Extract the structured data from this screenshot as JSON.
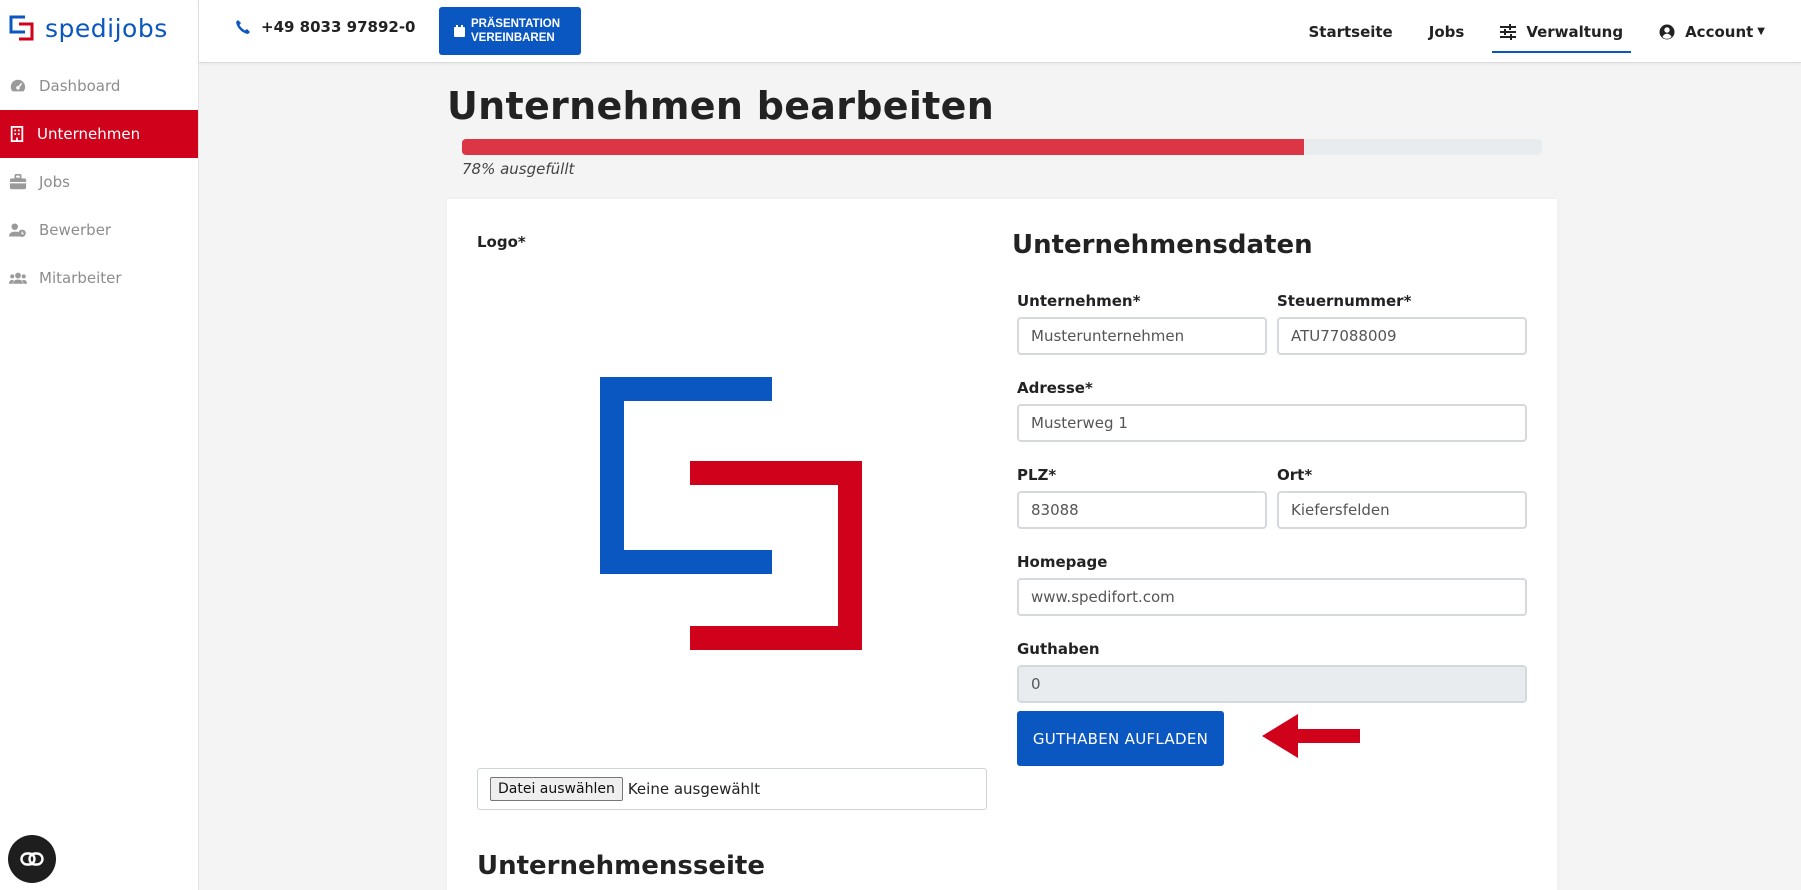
{
  "brand": {
    "name": "spedijobs",
    "colors": {
      "blue": "#0a57c2",
      "red": "#d0021b"
    }
  },
  "sidebar": {
    "items": [
      {
        "label": "Dashboard",
        "icon": "dashboard-icon"
      },
      {
        "label": "Unternehmen",
        "icon": "building-icon",
        "active": true
      },
      {
        "label": "Jobs",
        "icon": "briefcase-icon"
      },
      {
        "label": "Bewerber",
        "icon": "user-clock-icon"
      },
      {
        "label": "Mitarbeiter",
        "icon": "users-icon"
      }
    ]
  },
  "topbar": {
    "phone": "+49 8033 97892-0",
    "presentation_button": "PRÄSENTATION VEREINBAREN",
    "nav": {
      "home": "Startseite",
      "jobs": "Jobs",
      "admin": "Verwaltung",
      "account": "Account"
    }
  },
  "page": {
    "title": "Unternehmen bearbeiten",
    "progress": {
      "percent": 78,
      "text": "78% ausgefüllt"
    }
  },
  "logo_section": {
    "label": "Logo*",
    "file_button": "Datei auswählen",
    "file_status": "Keine ausgewählt"
  },
  "company_data": {
    "title": "Unternehmensdaten",
    "company_label": "Unternehmen*",
    "company_value": "Musterunternehmen",
    "tax_label": "Steuernummer*",
    "tax_value": "ATU77088009",
    "address_label": "Adresse*",
    "address_value": "Musterweg 1",
    "zip_label": "PLZ*",
    "zip_value": "83088",
    "city_label": "Ort*",
    "city_value": "Kiefersfelden",
    "homepage_label": "Homepage",
    "homepage_value": "www.spedifort.com",
    "credit_label": "Guthaben",
    "credit_value": "0",
    "charge_button": "GUTHABEN AUFLADEN"
  },
  "company_page": {
    "title": "Unternehmensseite"
  }
}
